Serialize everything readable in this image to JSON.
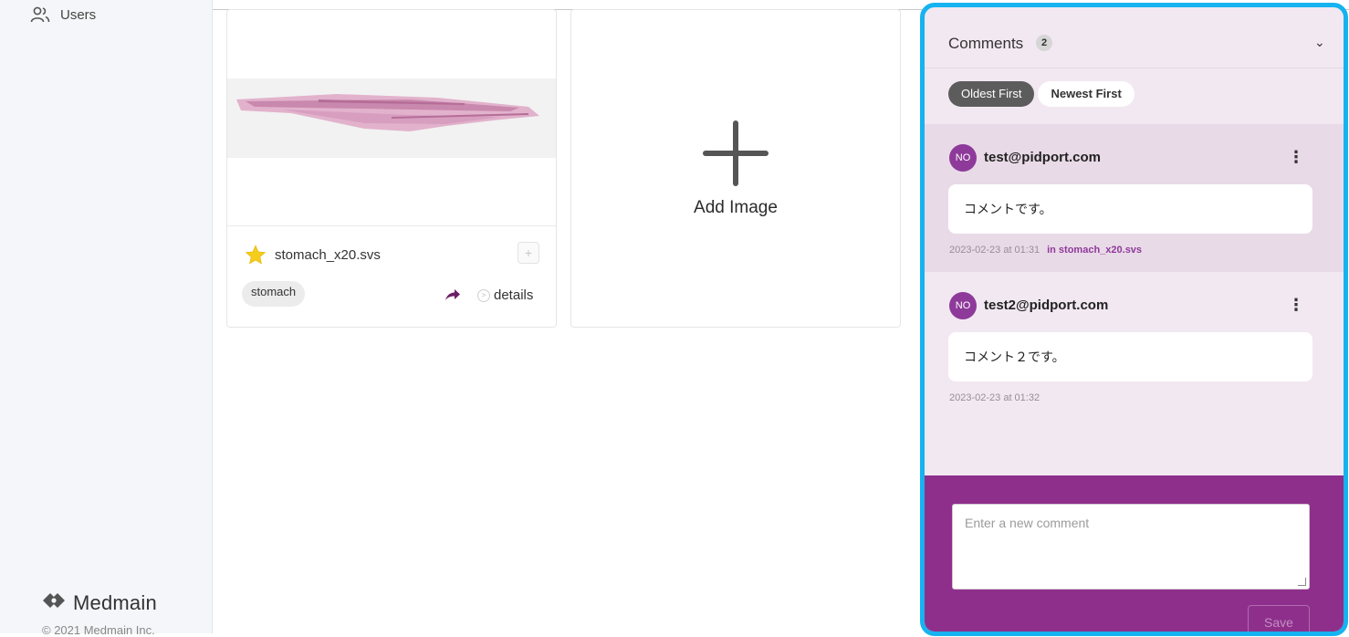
{
  "sidebar": {
    "users_label": "Users",
    "logo_text": "Medmain",
    "copyright": "© 2021 Medmain Inc."
  },
  "image_card": {
    "file_name": "stomach_x20.svs",
    "tag": "stomach",
    "details_label": "details",
    "favorite": true
  },
  "add_card": {
    "label": "Add Image"
  },
  "comments_panel": {
    "title": "Comments",
    "count": "2",
    "sort": {
      "oldest_label": "Oldest First",
      "newest_label": "Newest First",
      "selected": "Oldest First"
    },
    "comments": [
      {
        "avatar": "NO",
        "author": "test@pidport.com",
        "body": "コメントです。",
        "timestamp": "2023-02-23 at 01:31",
        "context": "in stomach_x20.svs"
      },
      {
        "avatar": "NO",
        "author": "test2@pidport.com",
        "body": "コメント２です。",
        "timestamp": "2023-02-23 at 01:32",
        "context": ""
      }
    ],
    "new_comment_placeholder": "Enter a new comment",
    "save_label": "Save"
  },
  "colors": {
    "accent": "#8e2f8c",
    "highlight_border": "#16b3f0",
    "panel_bg": "#f2e8f1"
  }
}
